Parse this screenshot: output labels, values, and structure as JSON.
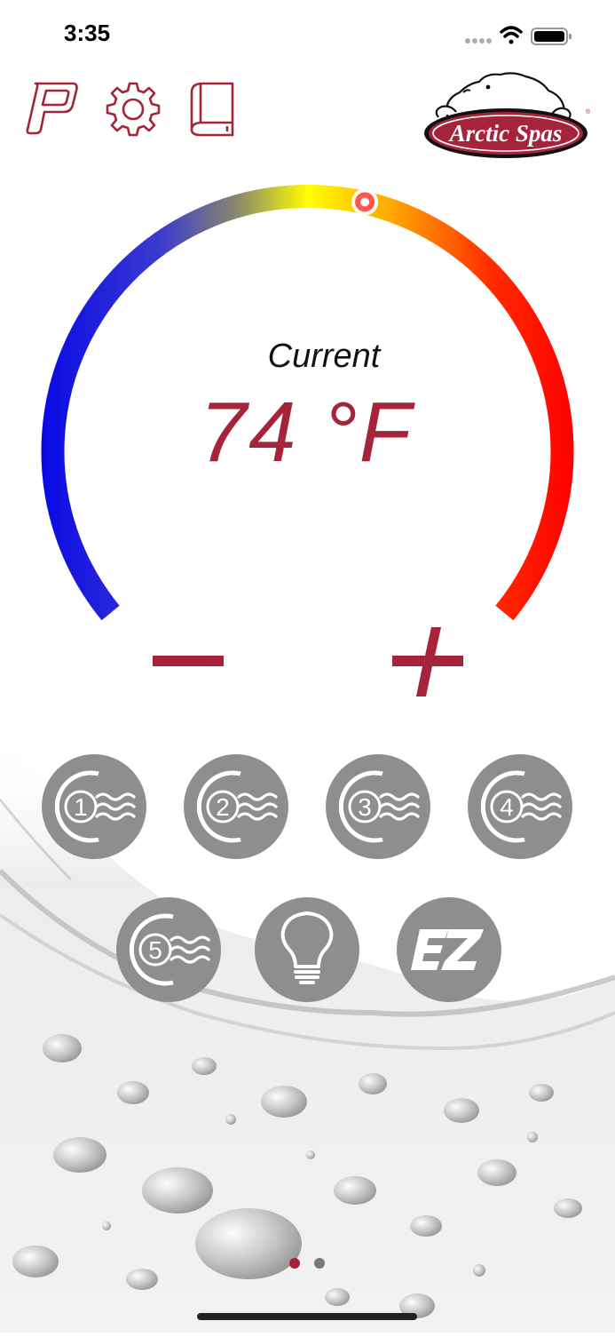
{
  "status_bar": {
    "time": "3:35",
    "icons": [
      "signal-dots-icon",
      "wifi-icon",
      "battery-icon"
    ]
  },
  "toolbar": {
    "icons": [
      "parking-p-icon",
      "gear-icon",
      "manual-book-icon"
    ],
    "logo_text": "Arctic Spas"
  },
  "thermostat": {
    "caption": "Current",
    "temperature": "74 °F",
    "setpoint_fraction": 0.55,
    "decrease_icon": "minus-icon",
    "increase_icon": "plus-icon"
  },
  "controls": {
    "pumps": [
      {
        "label": "1",
        "icon": "jet-pump-icon"
      },
      {
        "label": "2",
        "icon": "jet-pump-icon"
      },
      {
        "label": "3",
        "icon": "jet-pump-icon"
      },
      {
        "label": "4",
        "icon": "jet-pump-icon"
      },
      {
        "label": "5",
        "icon": "jet-pump-icon"
      }
    ],
    "light_icon": "lightbulb-icon",
    "ez_label": "EZ"
  },
  "pager": {
    "pages": 2,
    "current": 1
  },
  "colors": {
    "accent": "#a6243a",
    "button_gray": "#8e8e8e",
    "gauge_cold": "#0a0ae6",
    "gauge_mid": "#ffff00",
    "gauge_hot": "#ff0000"
  }
}
